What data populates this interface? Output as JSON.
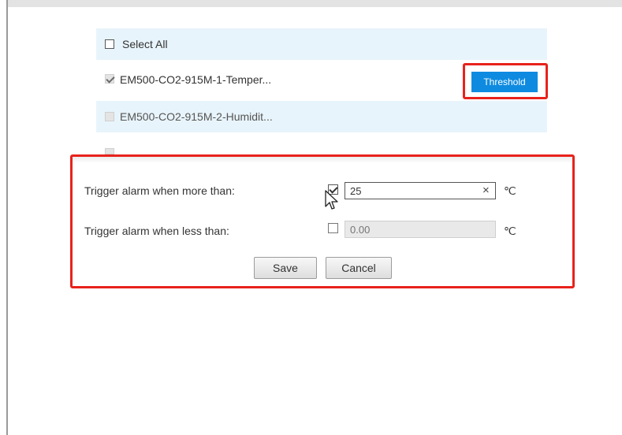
{
  "sensor_list": {
    "select_all_label": "Select All",
    "items": [
      {
        "label": "EM500-CO2-915M-1-Temper...",
        "checked": true,
        "enabled": true
      },
      {
        "label": "EM500-CO2-915M-2-Humidit...",
        "checked": false,
        "enabled": false
      }
    ],
    "threshold_label": "Threshold"
  },
  "threshold_dialog": {
    "more_than_label": "Trigger alarm when more than:",
    "more_than_checked": true,
    "more_than_value": "25",
    "less_than_label": "Trigger alarm when less than:",
    "less_than_checked": false,
    "less_than_placeholder": "0.00",
    "unit": "℃",
    "clear_glyph": "×",
    "save_label": "Save",
    "cancel_label": "Cancel"
  },
  "colors": {
    "highlight": "#e8221c",
    "accent": "#0e8be0",
    "row_background": "#e8f4fb"
  }
}
